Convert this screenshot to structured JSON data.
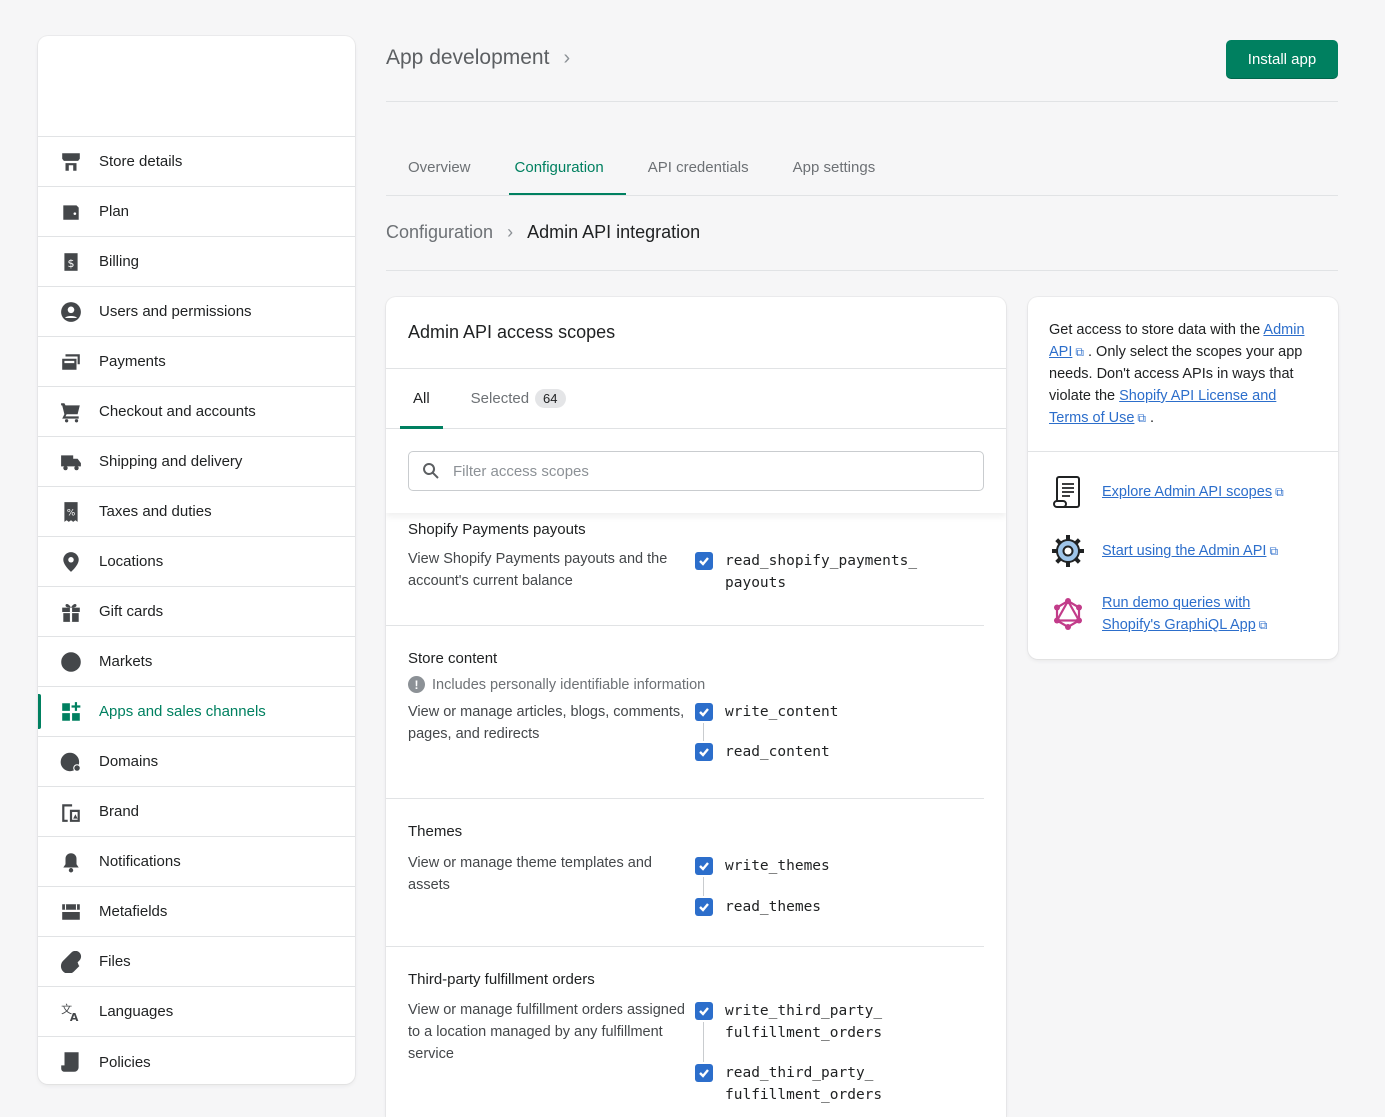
{
  "header": {
    "title": "App development",
    "install_label": "Install app"
  },
  "sidebar": {
    "items": [
      {
        "label": "Store details",
        "icon": "store-icon"
      },
      {
        "label": "Plan",
        "icon": "plan-icon"
      },
      {
        "label": "Billing",
        "icon": "billing-icon"
      },
      {
        "label": "Users and permissions",
        "icon": "user-icon"
      },
      {
        "label": "Payments",
        "icon": "payments-icon"
      },
      {
        "label": "Checkout and accounts",
        "icon": "cart-icon"
      },
      {
        "label": "Shipping and delivery",
        "icon": "truck-icon"
      },
      {
        "label": "Taxes and duties",
        "icon": "tax-icon"
      },
      {
        "label": "Locations",
        "icon": "location-pin-icon"
      },
      {
        "label": "Gift cards",
        "icon": "gift-icon"
      },
      {
        "label": "Markets",
        "icon": "globe-icon"
      },
      {
        "label": "Apps and sales channels",
        "icon": "apps-icon"
      },
      {
        "label": "Domains",
        "icon": "domain-globe-icon"
      },
      {
        "label": "Brand",
        "icon": "brand-icon"
      },
      {
        "label": "Notifications",
        "icon": "bell-icon"
      },
      {
        "label": "Metafields",
        "icon": "metafields-icon"
      },
      {
        "label": "Files",
        "icon": "paperclip-icon"
      },
      {
        "label": "Languages",
        "icon": "translate-icon"
      },
      {
        "label": "Policies",
        "icon": "policy-icon"
      }
    ]
  },
  "tabs": {
    "overview": "Overview",
    "configuration": "Configuration",
    "api_credentials": "API credentials",
    "app_settings": "App settings"
  },
  "breadcrumb": {
    "parent": "Configuration",
    "current": "Admin API integration"
  },
  "scopes_card": {
    "title": "Admin API access scopes",
    "tab_all": "All",
    "tab_selected": "Selected",
    "selected_count": "64",
    "search_placeholder": "Filter access scopes",
    "pii_note": "Includes personally identifiable information",
    "sections": {
      "payouts": {
        "title": "Shopify Payments payouts",
        "desc": "View Shopify Payments payouts and the account's current balance",
        "perm1_a": "read_shopify_payments_",
        "perm1_b": "payouts"
      },
      "content": {
        "title": "Store content",
        "desc": "View or manage articles, blogs, comments, pages, and redirects",
        "perm1": "write_content",
        "perm2": "read_content"
      },
      "themes": {
        "title": "Themes",
        "desc": "View or manage theme templates and assets",
        "perm1": "write_themes",
        "perm2": "read_themes"
      },
      "fulfillment": {
        "title": "Third-party fulfillment orders",
        "desc": "View or manage fulfillment orders assigned to a location managed by any fulfillment service",
        "perm1_a": "write_third_party_",
        "perm1_b": "fulfillment_orders",
        "perm2_a": "read_third_party_",
        "perm2_b": "fulfillment_orders"
      }
    }
  },
  "side_card": {
    "intro_1": "Get access to store data with the",
    "admin_api_link": "Admin API",
    "intro_2": ". Only select the scopes your app needs. Don't access APIs in ways that violate the",
    "license_link": "Shopify API License and Terms of Use",
    "intro_3": ".",
    "resources": {
      "explore": "Explore Admin API scopes",
      "start": "Start using the Admin API",
      "demo_1": "Run demo queries with",
      "demo_2": "Shopify's GraphiQL App"
    }
  }
}
